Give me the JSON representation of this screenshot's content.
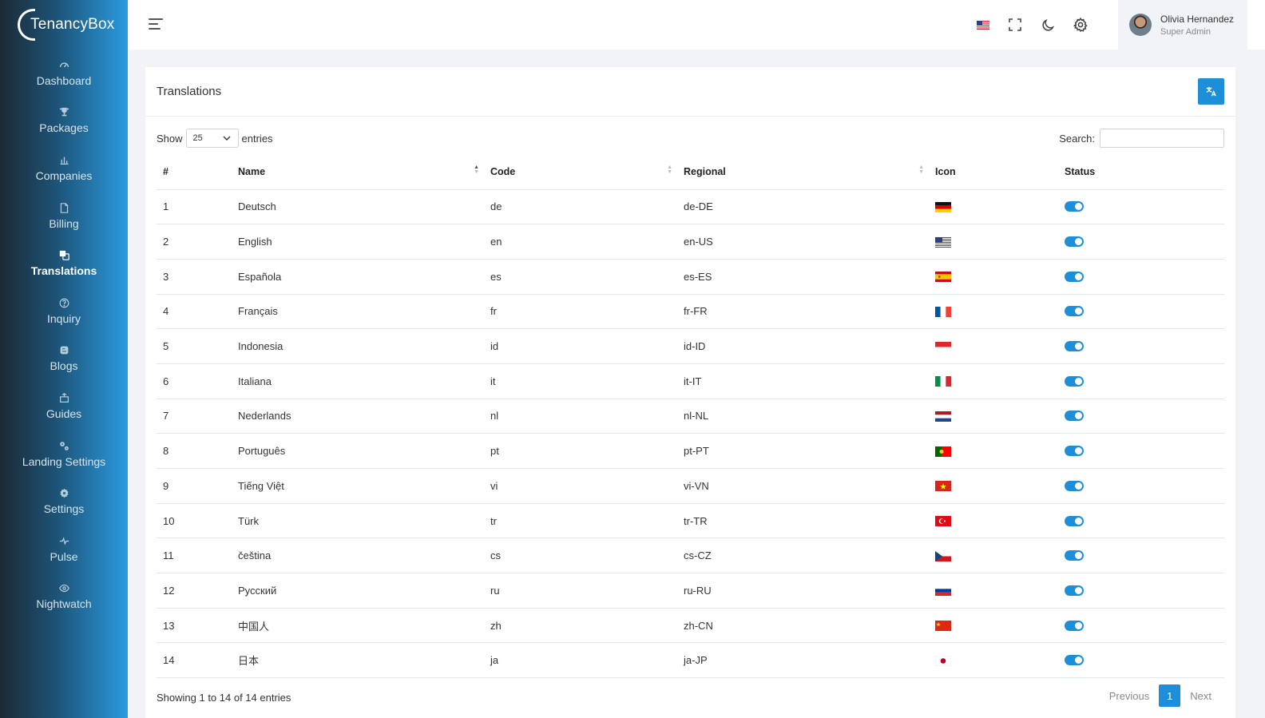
{
  "brand": {
    "name": "TenancyBox"
  },
  "sidebar": {
    "items": [
      {
        "label": "Dashboard",
        "icon": "dashboard-icon",
        "active": false
      },
      {
        "label": "Packages",
        "icon": "trophy-icon",
        "active": false
      },
      {
        "label": "Companies",
        "icon": "bar-chart-icon",
        "active": false
      },
      {
        "label": "Billing",
        "icon": "file-icon",
        "active": false
      },
      {
        "label": "Translations",
        "icon": "translate-icon",
        "active": true
      },
      {
        "label": "Inquiry",
        "icon": "question-icon",
        "active": false
      },
      {
        "label": "Blogs",
        "icon": "blog-icon",
        "active": false
      },
      {
        "label": "Guides",
        "icon": "guide-icon",
        "active": false
      },
      {
        "label": "Landing Settings",
        "icon": "cogs-icon",
        "active": false
      },
      {
        "label": "Settings",
        "icon": "gear-icon",
        "active": false
      },
      {
        "label": "Pulse",
        "icon": "pulse-icon",
        "active": false
      },
      {
        "label": "Nightwatch",
        "icon": "eye-icon",
        "active": false
      }
    ]
  },
  "header": {
    "user": {
      "name": "Olivia Hernandez",
      "role": "Super Admin"
    }
  },
  "card": {
    "title": "Translations",
    "show_label": "Show",
    "entries_value": "25",
    "entries_label": "entries",
    "search_label": "Search:",
    "search_value": "",
    "columns": [
      "#",
      "Name",
      "Code",
      "Regional",
      "Icon",
      "Status"
    ],
    "rows": [
      {
        "num": "1",
        "name": "Deutsch",
        "code": "de",
        "regional": "de-DE",
        "flag": "de",
        "status": true
      },
      {
        "num": "2",
        "name": "English",
        "code": "en",
        "regional": "en-US",
        "flag": "us",
        "status": true
      },
      {
        "num": "3",
        "name": "Española",
        "code": "es",
        "regional": "es-ES",
        "flag": "es",
        "status": true
      },
      {
        "num": "4",
        "name": "Français",
        "code": "fr",
        "regional": "fr-FR",
        "flag": "fr",
        "status": true
      },
      {
        "num": "5",
        "name": "Indonesia",
        "code": "id",
        "regional": "id-ID",
        "flag": "id",
        "status": true
      },
      {
        "num": "6",
        "name": "Italiana",
        "code": "it",
        "regional": "it-IT",
        "flag": "it",
        "status": true
      },
      {
        "num": "7",
        "name": "Nederlands",
        "code": "nl",
        "regional": "nl-NL",
        "flag": "nl",
        "status": true
      },
      {
        "num": "8",
        "name": "Português",
        "code": "pt",
        "regional": "pt-PT",
        "flag": "pt",
        "status": true
      },
      {
        "num": "9",
        "name": "Tiếng Việt",
        "code": "vi",
        "regional": "vi-VN",
        "flag": "vn",
        "status": true
      },
      {
        "num": "10",
        "name": "Türk",
        "code": "tr",
        "regional": "tr-TR",
        "flag": "tr",
        "status": true
      },
      {
        "num": "11",
        "name": "čeština",
        "code": "cs",
        "regional": "cs-CZ",
        "flag": "cz",
        "status": true
      },
      {
        "num": "12",
        "name": "Русский",
        "code": "ru",
        "regional": "ru-RU",
        "flag": "ru",
        "status": true
      },
      {
        "num": "13",
        "name": "中国人",
        "code": "zh",
        "regional": "zh-CN",
        "flag": "cn",
        "status": true
      },
      {
        "num": "14",
        "name": "日本",
        "code": "ja",
        "regional": "ja-JP",
        "flag": "jp",
        "status": true
      }
    ],
    "info": "Showing 1 to 14 of 14 entries",
    "pagination": {
      "previous": "Previous",
      "current": "1",
      "next": "Next"
    }
  },
  "colors": {
    "accent": "#1d8fd8",
    "sidebar_dark": "#1c2a35",
    "sidebar_light": "#2b9be0"
  }
}
